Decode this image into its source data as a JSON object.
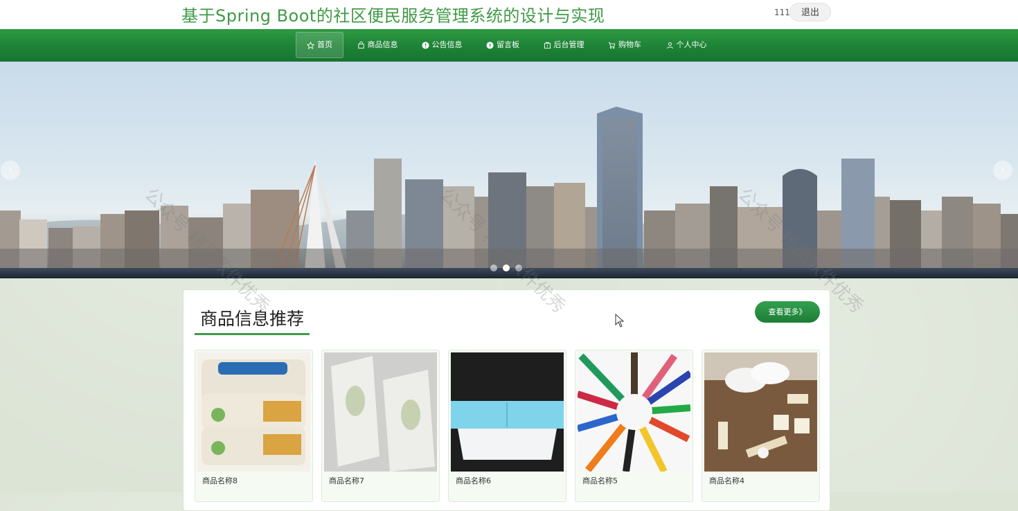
{
  "header": {
    "site_title": "基于Spring Boot的社区便民服务管理系统的设计与实现",
    "username": "111",
    "logout_label": "退出"
  },
  "nav": {
    "items": [
      {
        "label": "首页",
        "icon": "star-icon",
        "active": true
      },
      {
        "label": "商品信息",
        "icon": "bag-icon"
      },
      {
        "label": "公告信息",
        "icon": "info-icon"
      },
      {
        "label": "留言板",
        "icon": "question-icon"
      },
      {
        "label": "后台管理",
        "icon": "dashboard-icon"
      },
      {
        "label": "购物车",
        "icon": "cart-icon"
      },
      {
        "label": "个人中心",
        "icon": "user-icon"
      }
    ]
  },
  "carousel": {
    "prev_icon": "chevron-left-icon",
    "next_icon": "chevron-right-icon",
    "prev_glyph": "‹",
    "next_glyph": "›",
    "dots": 3,
    "active_dot": 2
  },
  "recommend": {
    "title": "商品信息推荐",
    "more_label": "查看更多》",
    "products": [
      {
        "name": "商品名称8"
      },
      {
        "name": "商品名称7"
      },
      {
        "name": "商品名称6"
      },
      {
        "name": "商品名称5"
      },
      {
        "name": "商品名称4"
      }
    ]
  },
  "watermark_text": "公众号 精品软件优秀",
  "colors": {
    "brand_green": "#3f9a45",
    "nav_green": "#1e8437",
    "background": "#dce4d6"
  }
}
